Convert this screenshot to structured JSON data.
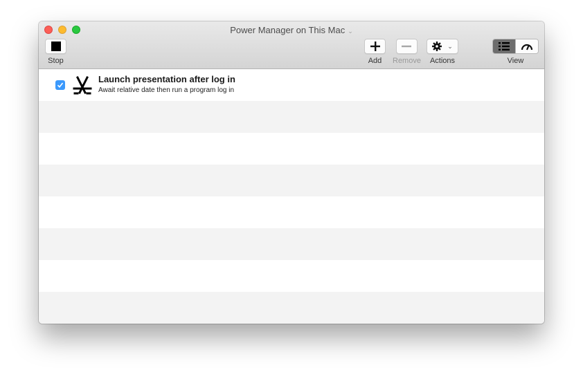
{
  "window": {
    "title": "Power Manager on This Mac"
  },
  "toolbar": {
    "stop_label": "Stop",
    "add_label": "Add",
    "remove_label": "Remove",
    "actions_label": "Actions",
    "view_label": "View",
    "icons": {
      "stop": "stop-square-icon",
      "add": "plus-icon",
      "remove": "minus-icon",
      "actions": "gear-icon",
      "view_list": "list-icon",
      "view_gauge": "gauge-icon"
    },
    "view_selected": "list"
  },
  "events": [
    {
      "enabled": true,
      "title": "Launch presentation after log in",
      "subtitle": "Await relative date then run a program log in",
      "icon": "app-store-a-icon"
    }
  ],
  "colors": {
    "checkbox": "#3b99fc",
    "row_alt": "#f3f3f3",
    "close": "#fc5f57",
    "minimize": "#fdbb2e",
    "maximize": "#29c840"
  }
}
